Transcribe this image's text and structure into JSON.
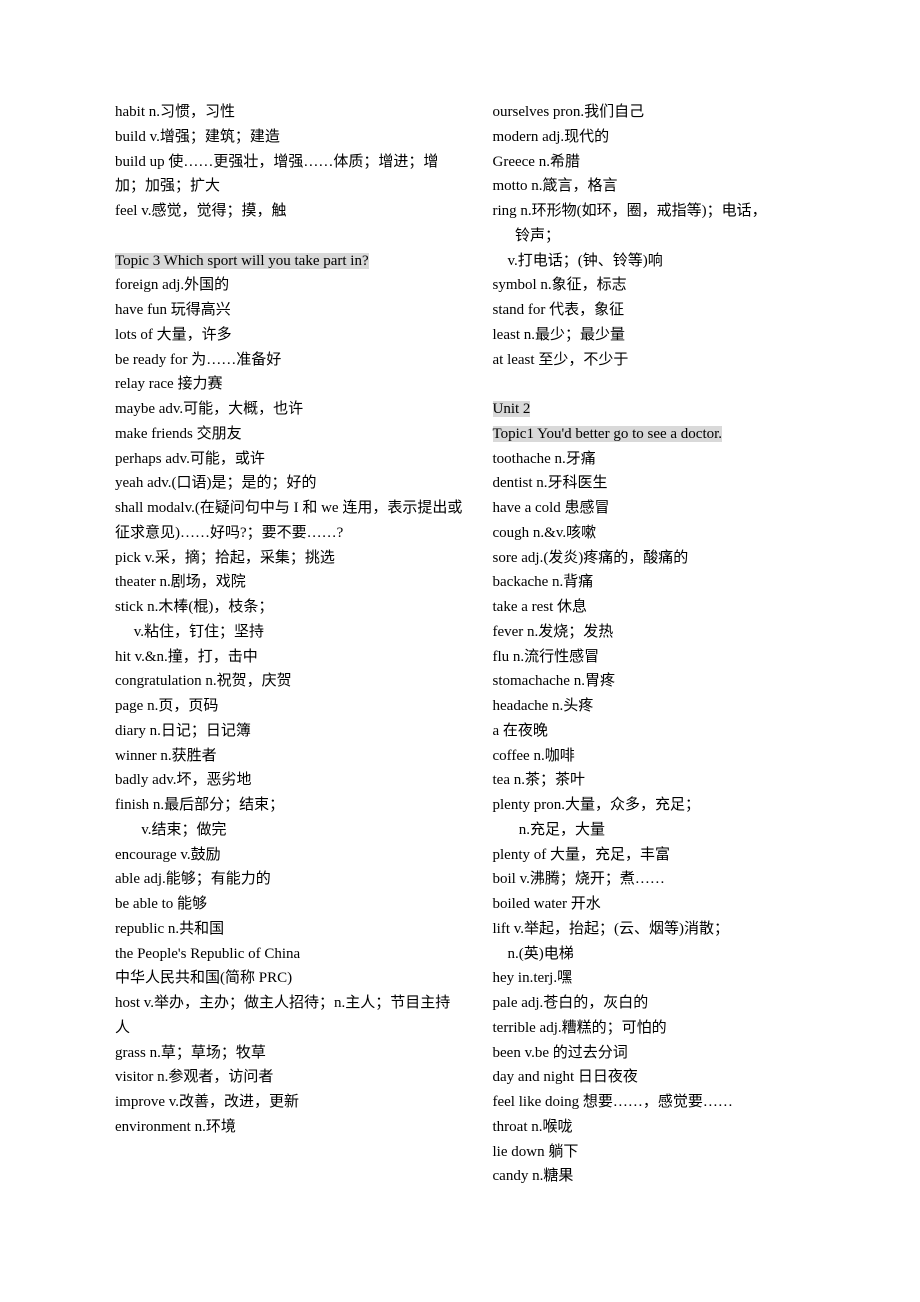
{
  "left": {
    "pre": [
      "habit  n.习惯，习性",
      "build  v.增强；建筑；建造",
      "build up 使……更强壮，增强……体质；增进；增加；加强；扩大",
      "feel  v.感觉，觉得；摸，触"
    ],
    "topic": "Topic 3 Which sport will you take part in?",
    "entries": [
      "foreign  adj.外国的",
      "have fun  玩得高兴",
      "lots of  大量，许多",
      "be ready for  为……准备好",
      "relay race  接力赛",
      "maybe  adv.可能，大概，也许",
      "make friends  交朋友",
      "perhaps  adv.可能，或许",
      "yeah  adv.(口语)是；是的；好的",
      "shall  modalv.(在疑问句中与 I 和 we 连用，表示提出或征求意见)……好吗?；要不要……?",
      "pick  v.采，摘；拾起，采集；挑选",
      "theater  n.剧场，戏院",
      "stick  n.木棒(棍)，枝条；",
      "     v.粘住，钉住；坚持",
      "hit  v.&n.撞，打，击中",
      "congratulation  n.祝贺，庆贺",
      "page  n.页，页码",
      "diary  n.日记；日记簿",
      "winner  n.获胜者",
      "badly  adv.坏，恶劣地",
      "finish  n.最后部分；结束；",
      "       v.结束；做完",
      "encourage  v.鼓励",
      "able  adj.能够；有能力的",
      "be able to  能够",
      "republic  n.共和国",
      "the People's Republic of China",
      "中华人民共和国(简称 PRC)",
      "host  v.举办，主办；做主人招待；n.主人；节目主持人",
      "grass  n.草；草场；牧草",
      "visitor  n.参观者，访问者",
      "improve  v.改善，改进，更新",
      "environment  n.环境"
    ]
  },
  "right": {
    "pre": [
      "ourselves  pron.我们自己",
      "modern  adj.现代的",
      "Greece  n.希腊",
      "motto  n.箴言，格言",
      "ring  n.环形物(如环，圈，戒指等)；电话，",
      "      铃声；",
      "    v.打电话；(钟、铃等)响",
      "symbol  n.象征，标志",
      "stand for  代表，象征",
      "least  n.最少；最少量",
      "at least  至少，不少于"
    ],
    "unit": "Unit 2",
    "topic": "Topic1 You'd better go to see a doctor.",
    "entries": [
      "toothache  n.牙痛",
      "dentist  n.牙科医生",
      "have a cold  患感冒",
      "cough  n.&v.咳嗽",
      "sore  adj.(发炎)疼痛的，酸痛的",
      "backache  n.背痛",
      "take a rest  休息",
      "fever  n.发烧；发热",
      "flu  n.流行性感冒",
      "stomachache  n.胃疼",
      "headache  n.头疼",
      "a  在夜晚",
      "coffee  n.咖啡",
      "tea  n.茶；茶叶",
      "plenty  pron.大量，众多，充足；",
      "       n.充足，大量",
      "plenty of  大量，充足，丰富",
      "boil  v.沸腾；烧开；煮……",
      "boiled water  开水",
      "lift  v.举起，抬起；(云、烟等)消散；",
      "    n.(英)电梯",
      "hey  in.terj.嘿",
      "pale  adj.苍白的，灰白的",
      "terrible  adj.糟糕的；可怕的",
      "been  v.be 的过去分词",
      "day and night  日日夜夜",
      "feel like doing  想要……，感觉要……",
      "throat  n.喉咙",
      "lie down  躺下",
      "candy  n.糖果"
    ]
  }
}
